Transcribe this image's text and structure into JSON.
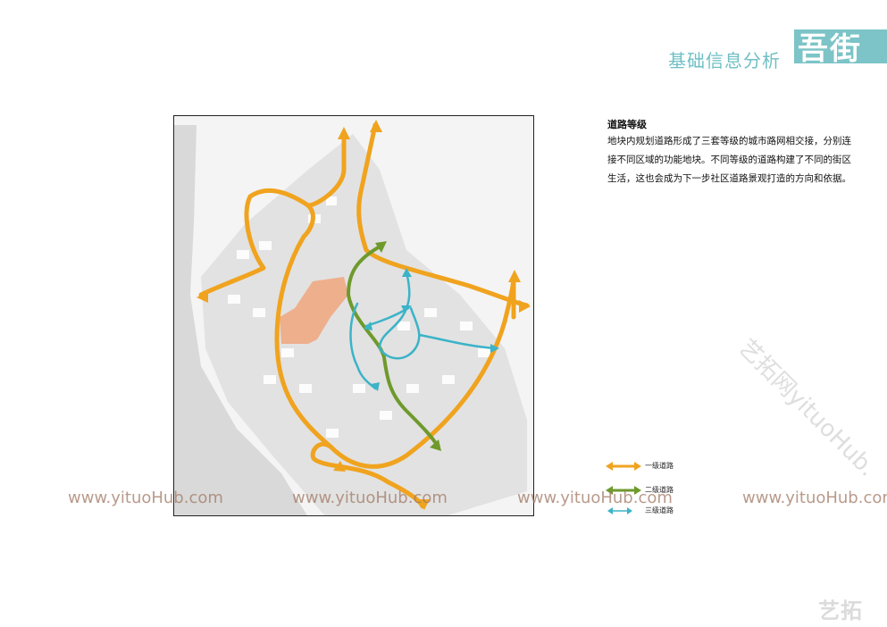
{
  "header": {
    "title": "基础信息分析",
    "brand": "吾街"
  },
  "section": {
    "title": "道路等级",
    "body": "地块内规划道路形成了三套等级的城市路网相交接，分别连接不同区域的功能地块。不同等级的道路构建了不同的街区生活，这也会成为下一步社区道路景观打造的方向和依据。"
  },
  "legend": [
    {
      "label": "一级道路",
      "color": "#f0a31e"
    },
    {
      "label": "二级道路",
      "color": "#6e9a2c"
    },
    {
      "label": "三级道路",
      "color": "#3bb3c8"
    }
  ],
  "watermarks": [
    "www.yituoHub.com",
    "www.yituoHub.com",
    "www.yituoHub.com",
    "www.yituoHub.com"
  ],
  "watermark_diag": "艺拓网yituoHub.",
  "corner_logo": "艺拓",
  "colors": {
    "primary_road": "#f0a31e",
    "secondary_road": "#6e9a2c",
    "tertiary_road": "#3bb3c8",
    "highlight_block": "#f0a67d",
    "accent": "#7cc4c7"
  }
}
